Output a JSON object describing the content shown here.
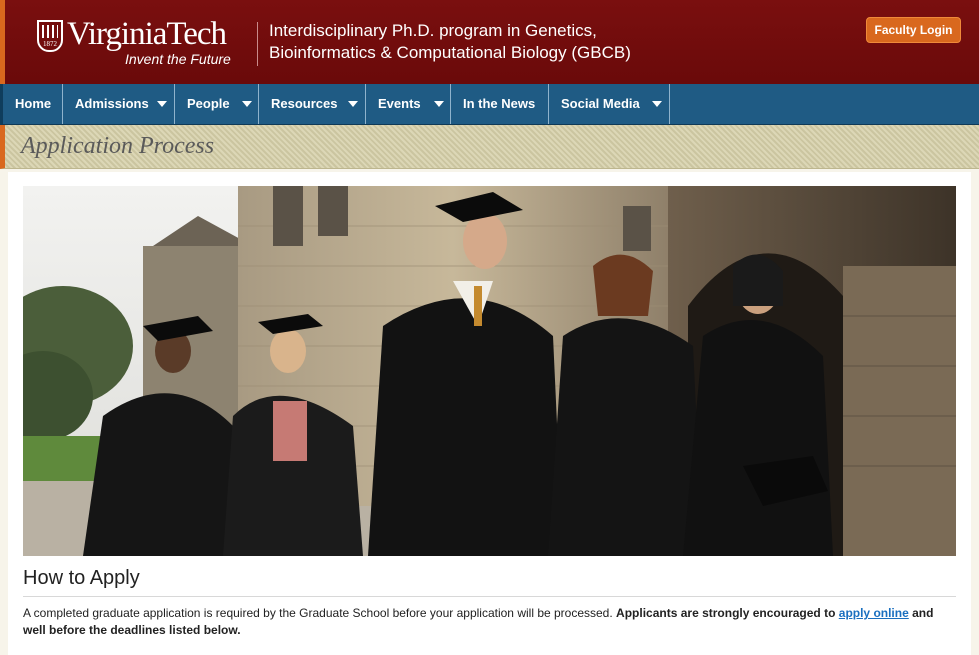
{
  "header": {
    "logo": {
      "brand": "VirginiaTech",
      "tagline": "Invent the Future",
      "year": "1872"
    },
    "program_line1": "Interdisciplinary Ph.D. program in Genetics,",
    "program_line2": "Bioinformatics & Computational Biology (GBCB)",
    "faculty_login": "Faculty Login"
  },
  "nav": {
    "items": [
      {
        "label": "Home"
      },
      {
        "label": "Admissions"
      },
      {
        "label": "People"
      },
      {
        "label": "Resources"
      },
      {
        "label": "Events"
      },
      {
        "label": "In the News"
      },
      {
        "label": "Social Media"
      }
    ]
  },
  "page": {
    "section_title": "Application Process",
    "how_title": "How to Apply",
    "para_part1": "A completed graduate application is required by the Graduate School before your application will be processed.",
    "para_bold1": "Applicants are strongly encouraged to",
    "para_link": "apply online",
    "para_bold2": "and well before the deadlines listed below."
  },
  "colors": {
    "maroon": "#6a0a0a",
    "orange": "#d9681e",
    "nav_blue": "#1f5b84",
    "link": "#1a6fbf"
  }
}
